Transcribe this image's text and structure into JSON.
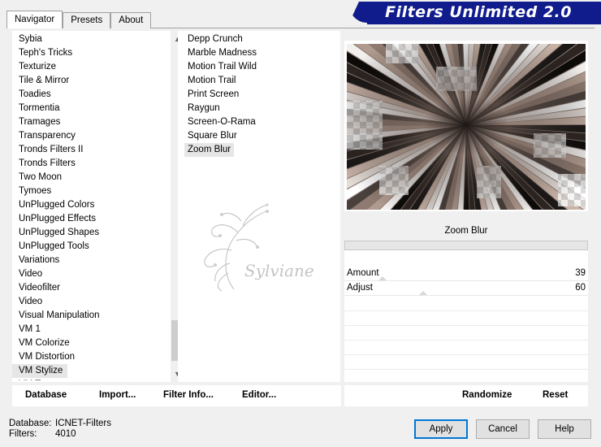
{
  "tabs": [
    {
      "label": "Navigator",
      "active": true
    },
    {
      "label": "Presets",
      "active": false
    },
    {
      "label": "About",
      "active": false
    }
  ],
  "banner": {
    "title": "Filters Unlimited 2.0",
    "color": "#101c8c"
  },
  "categories": {
    "items": [
      "Sybia",
      "Teph's Tricks",
      "Texturize",
      "Tile & Mirror",
      "Toadies",
      "Tormentia",
      "Tramages",
      "Transparency",
      "Tronds Filters II",
      "Tronds Filters",
      "Two Moon",
      "Tymoes",
      "UnPlugged Colors",
      "UnPlugged Effects",
      "UnPlugged Shapes",
      "UnPlugged Tools",
      "Variations",
      "Video",
      "Videofilter",
      "Video",
      "Visual Manipulation",
      "VM 1",
      "VM Colorize",
      "VM Distortion",
      "VM Stylize",
      "VM Texture"
    ],
    "selected": "VM Stylize"
  },
  "filters": {
    "items": [
      "Depp Crunch",
      "Marble Madness",
      "Motion Trail Wild",
      "Motion Trail",
      "Print Screen",
      "Raygun",
      "Screen-O-Rama",
      "Square Blur",
      "Zoom Blur"
    ],
    "selected": "Zoom Blur"
  },
  "watermark": {
    "text": "Sylviane"
  },
  "controls": {
    "title": "Zoom Blur",
    "params": [
      {
        "label": "Amount",
        "value": "39"
      },
      {
        "label": "Adjust",
        "value": "60"
      }
    ]
  },
  "left_buttons": {
    "database": "Database",
    "import": "Import...",
    "filter_info": "Filter Info...",
    "editor": "Editor..."
  },
  "right_buttons": {
    "randomize": "Randomize",
    "reset": "Reset"
  },
  "status": {
    "database_label": "Database:",
    "database_value": "ICNET-Filters",
    "filters_label": "Filters:",
    "filters_value": "4010"
  },
  "dialog_buttons": {
    "apply": "Apply",
    "cancel": "Cancel",
    "help": "Help"
  }
}
